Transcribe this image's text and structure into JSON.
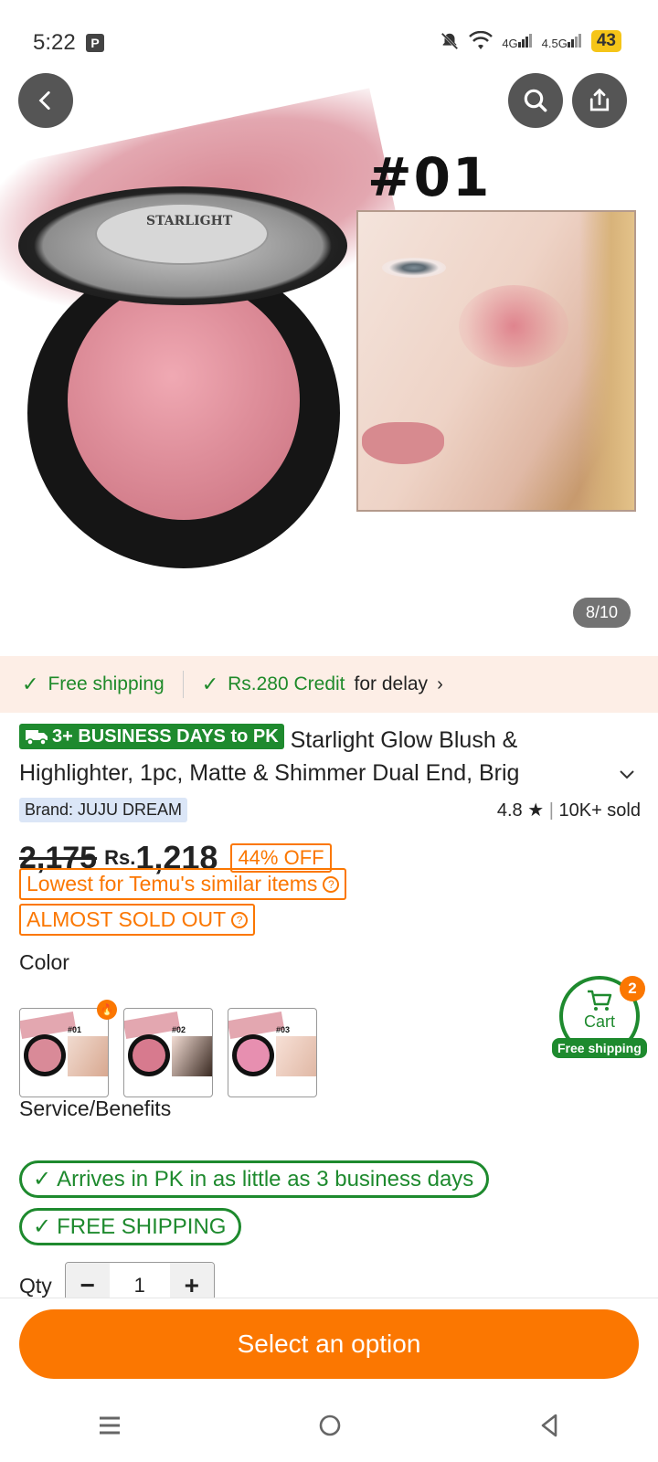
{
  "status_bar": {
    "time": "5:22",
    "p_badge": "P",
    "net1": "4G",
    "net2": "4.5G",
    "battery": "43"
  },
  "hero": {
    "shade_title": "#01",
    "compact_brand": "STARLIGHT",
    "page_indicator": "8/10"
  },
  "shipping_strip": {
    "free_shipping": "Free shipping",
    "credit": "Rs.280 Credit",
    "credit_suffix": "for delay"
  },
  "product": {
    "days_badge": "3+ BUSINESS DAYS to PK",
    "title": "Starlight Glow Blush & Highlighter, 1pc, Matte & Shimmer Dual End, Brig",
    "brand": "Brand: JUJU DREAM",
    "rating": "4.8",
    "sold": "10K+ sold",
    "old_price": "2,175",
    "currency": "Rs.",
    "new_price": "1,218",
    "discount": "44% OFF",
    "lowest_tag": "Lowest for Temu's similar items",
    "sold_out_tag": "ALMOST SOLD OUT"
  },
  "color": {
    "label": "Color",
    "options": [
      {
        "label": "#01",
        "pan": "#d98a98"
      },
      {
        "label": "#02",
        "pan": "#d77a8e"
      },
      {
        "label": "#03",
        "pan": "#e78fb0"
      }
    ]
  },
  "cart": {
    "label": "Cart",
    "count": "2",
    "ship_label": "Free shipping"
  },
  "service": {
    "label": "Service/Benefits",
    "arrives": "Arrives in PK in as little as 3 business days",
    "free_shipping": "FREE SHIPPING"
  },
  "qty": {
    "label": "Qty",
    "value": "1"
  },
  "cta": {
    "label": "Select an option"
  },
  "colors": {
    "accent_orange": "#fb7701",
    "accent_green": "#1e8a2e",
    "strip_bg": "#fdeee6"
  }
}
